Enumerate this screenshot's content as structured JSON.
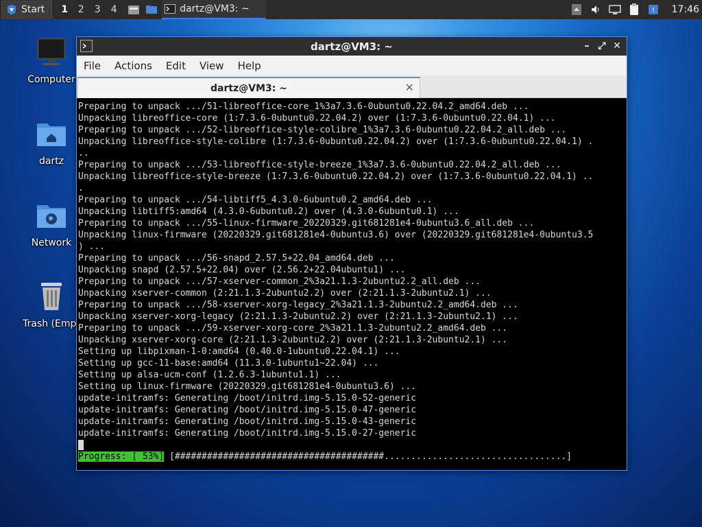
{
  "panel": {
    "start_label": "Start",
    "workspaces": [
      "1",
      "2",
      "3",
      "4"
    ],
    "task_title": "dartz@VM3: ~",
    "clock": "17:46"
  },
  "desktop": {
    "icons": [
      {
        "label": "Computer"
      },
      {
        "label": "dartz"
      },
      {
        "label": "Network"
      },
      {
        "label": "Trash (Empt"
      }
    ]
  },
  "window": {
    "title": "dartz@VM3: ~",
    "menu": [
      "File",
      "Actions",
      "Edit",
      "View",
      "Help"
    ],
    "tab_title": "dartz@VM3: ~",
    "terminal_lines": [
      "Preparing to unpack .../51-libreoffice-core_1%3a7.3.6-0ubuntu0.22.04.2_amd64.deb ...",
      "Unpacking libreoffice-core (1:7.3.6-0ubuntu0.22.04.2) over (1:7.3.6-0ubuntu0.22.04.1) ...",
      "Preparing to unpack .../52-libreoffice-style-colibre_1%3a7.3.6-0ubuntu0.22.04.2_all.deb ...",
      "Unpacking libreoffice-style-colibre (1:7.3.6-0ubuntu0.22.04.2) over (1:7.3.6-0ubuntu0.22.04.1) .",
      "..",
      "Preparing to unpack .../53-libreoffice-style-breeze_1%3a7.3.6-0ubuntu0.22.04.2_all.deb ...",
      "Unpacking libreoffice-style-breeze (1:7.3.6-0ubuntu0.22.04.2) over (1:7.3.6-0ubuntu0.22.04.1) ..",
      ".",
      "Preparing to unpack .../54-libtiff5_4.3.0-6ubuntu0.2_amd64.deb ...",
      "Unpacking libtiff5:amd64 (4.3.0-6ubuntu0.2) over (4.3.0-6ubuntu0.1) ...",
      "Preparing to unpack .../55-linux-firmware_20220329.git681281e4-0ubuntu3.6_all.deb ...",
      "Unpacking linux-firmware (20220329.git681281e4-0ubuntu3.6) over (20220329.git681281e4-0ubuntu3.5",
      ") ...",
      "Preparing to unpack .../56-snapd_2.57.5+22.04_amd64.deb ...",
      "Unpacking snapd (2.57.5+22.04) over (2.56.2+22.04ubuntu1) ...",
      "Preparing to unpack .../57-xserver-common_2%3a21.1.3-2ubuntu2.2_all.deb ...",
      "Unpacking xserver-common (2:21.1.3-2ubuntu2.2) over (2:21.1.3-2ubuntu2.1) ...",
      "Preparing to unpack .../58-xserver-xorg-legacy_2%3a21.1.3-2ubuntu2.2_amd64.deb ...",
      "Unpacking xserver-xorg-legacy (2:21.1.3-2ubuntu2.2) over (2:21.1.3-2ubuntu2.1) ...",
      "Preparing to unpack .../59-xserver-xorg-core_2%3a21.1.3-2ubuntu2.2_amd64.deb ...",
      "Unpacking xserver-xorg-core (2:21.1.3-2ubuntu2.2) over (2:21.1.3-2ubuntu2.1) ...",
      "Setting up libpixman-1-0:amd64 (0.40.0-1ubuntu0.22.04.1) ...",
      "Setting up gcc-11-base:amd64 (11.3.0-1ubuntu1~22.04) ...",
      "Setting up alsa-ucm-conf (1.2.6.3-1ubuntu1.1) ...",
      "Setting up linux-firmware (20220329.git681281e4-0ubuntu3.6) ...",
      "update-initramfs: Generating /boot/initrd.img-5.15.0-52-generic",
      "update-initramfs: Generating /boot/initrd.img-5.15.0-47-generic",
      "update-initramfs: Generating /boot/initrd.img-5.15.0-43-generic",
      "update-initramfs: Generating /boot/initrd.img-5.15.0-27-generic"
    ],
    "progress_label": "Progress: [ 53%]",
    "progress_bar": "[#######################################..................................]",
    "progress_percent": 53
  },
  "colors": {
    "progress_green": "#3fc132",
    "accent_blue": "#5b8fd6"
  }
}
